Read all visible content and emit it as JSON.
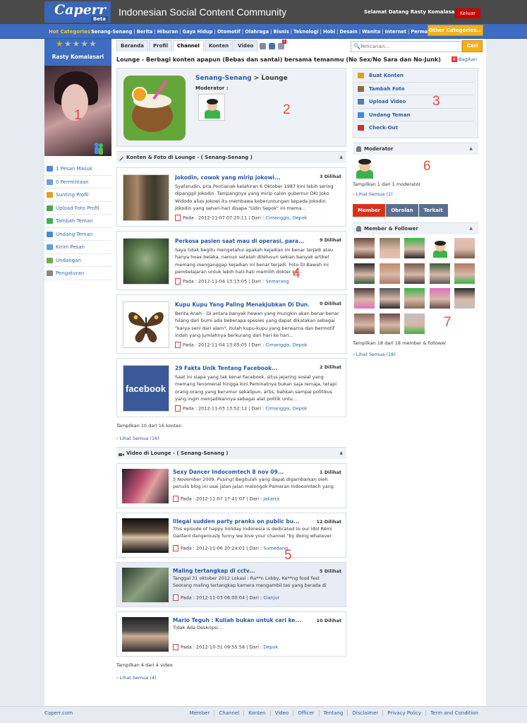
{
  "header": {
    "logo_text": "Caperr",
    "logo_badge": "Beta",
    "tagline": "Indonesian Social Content Community",
    "welcome": "Selamat Datang Rasty Komalasari,",
    "logout_label": "Keluar"
  },
  "categories": {
    "label": "Hot Categories :",
    "items": [
      "Senang-Senang",
      "Berita",
      "Hiburan",
      "Gaya Hidup",
      "Otomotif",
      "Olahraga",
      "Bisnis",
      "Teknologi",
      "Hobi",
      "Desain",
      "Wanita",
      "Internet",
      "Permainan"
    ],
    "other_label": "Other Categories..."
  },
  "profile": {
    "name": "Rasty Komalasari",
    "rating": 1,
    "rating_max": 5,
    "annotation": "1",
    "menu": [
      {
        "label": "1 Pesan Masuk",
        "icon": "mail-icon"
      },
      {
        "label": "0 Permintaan",
        "icon": "request-icon"
      },
      {
        "label": "Sunting Profil",
        "icon": "edit-icon"
      },
      {
        "label": "Upload Foto Profil",
        "icon": "photo-upload-icon"
      },
      {
        "label": "Tambah Teman",
        "icon": "add-friend-icon"
      },
      {
        "label": "Undang Teman",
        "icon": "invite-friend-icon"
      },
      {
        "label": "Kirim Pesan",
        "icon": "send-message-icon"
      },
      {
        "label": "Undangan",
        "icon": "invitation-icon"
      },
      {
        "label": "Pengaturan",
        "icon": "settings-icon"
      }
    ]
  },
  "tabs": [
    {
      "label": "Beranda",
      "active": false
    },
    {
      "label": "Profil",
      "active": false
    },
    {
      "label": "Channel",
      "active": true
    },
    {
      "label": "Konten",
      "active": false
    },
    {
      "label": "Video",
      "active": false
    }
  ],
  "notification_count": "1",
  "search": {
    "placeholder": "Pencarian...",
    "button_label": "Cari"
  },
  "page_title": "Lounge - Berbagi konten apapun (Bebas dan santai) bersama temanmu (No Sex/No Sara dan No-Junk)",
  "share_label": "Bagikan",
  "channel": {
    "category": "Senang-Senang",
    "name": "> Lounge",
    "moderator_label": "Moderator :",
    "annotation": "2"
  },
  "content_section": {
    "title": "Konten & Foto di Lounge - ( Senang-Senang )",
    "annotation": "4",
    "items": [
      {
        "title": "Jokodin, cowok yang mirip jokowi...",
        "views": "3 Dilihat",
        "desc": "Syafarudin, pria Pontianak kelahiran 6 Oktober 1987 kini lebih sering dipanggil Jokodin. Tampangnya yang mirip calon gubernur DKI Joko Widodo alias Jokowi itu membawa keberuntungan kepada Jokodin. Jokodin yang sehari-hari disapa \"Udin Sepok\" ini mema...",
        "date": "Pada : 2012-11-07 07:20:11",
        "from_label": "Dari :",
        "from": "Cimanggis, Depok"
      },
      {
        "title": "Perkosa pasien saat mau di operasi, para...",
        "views": "9 Dilihat",
        "desc": "Saya tidak begitu mengetahui apakah kejadian ini benar terjadi atau hanya hoax belaka, namun setelah ditelusuri sekian banyak artikel memang menganggap kejadian ini benar terjadi. Foto Di Bawah ini pembelajaran untuk lebih hati-hati memilih dokter ka...",
        "date": "Pada : 2012-11-04 13:13:05",
        "from_label": "Dari :",
        "from": "Semarang"
      },
      {
        "title": "Kupu Kupu Yang Paling Menakjubkan Di Dun...",
        "views": "0 Dilihat",
        "desc": "Berita Aneh - Di antara banyak hewan yang mungkin akan benar-benar hilang dari bumi ada beberapa spesies yang dapat dikatakan sebagai \"karya seni dari alam\", itulah kupu-kupu yang berwarna dan bermotif indah yang jumlahnya berkurang dari hari ke hari...",
        "date": "Pada : 2012-11-04 13:05:05",
        "from_label": "Dari :",
        "from": "Cimanggis, Depok"
      },
      {
        "title": "29 Fakta Unik Tentang Facebook...",
        "views": "2 Dilihat",
        "desc": "Saat ini siapa yang tak kenal Facebook, situs jejaring sosial yang memang fenomenal hingga kini.Peminatnya bukan saja remaja, tetapi orang-orang yang berumur sekalipun, artis, bahkan sampai politikus yang ingin menjadikannya sebagai alat politik untu...",
        "date": "Pada : 2012-11-03 13:52:12",
        "from_label": "Dari :",
        "from": "Cimanggis, Depok",
        "thumb_text": "facebook"
      }
    ],
    "count_text": "Tampilkan 10 dari 16 konten",
    "see_all": "Lihat Semua (16)"
  },
  "video_section": {
    "title": "Video di Lounge - ( Senang-Senang )",
    "annotation": "5",
    "items": [
      {
        "title": "Sexy Dancer Indocomtech 8 nov 09...",
        "views": "1 Dilihat",
        "desc": "5 November 2009. Pusing! Begitulah yang dapat digambarkan oleh penulis blog ini usai jalan-jalan melongok Pameran Indocomtech yang diselenggarakan di ...",
        "date": "Pada : 2012-11-07 17:41:07",
        "from_label": "Dari :",
        "from": "Jakarta"
      },
      {
        "title": "Illegal sudden party pranks on public bu...",
        "views": "12 Dilihat",
        "desc": "This episode of happy holiday Indonesia is dedicated to our idol Rémi Gaillard dangerously funny we love your channel \"by doing whatever anybody can b...",
        "date": "Pada : 2012-11-06 20:24:01",
        "from_label": "Dari :",
        "from": "Sumedang"
      },
      {
        "title": "Maling tertangkap di cctv...",
        "views": "5 Dilihat",
        "desc": "Tanggal 31 oktober 2012 Lokasi : Ra**n Lobby, Ke**ng food fest Seorang maling tertangkap kamera mengambil tas yang berada di sekitar kaki ( kiri...",
        "date": "Pada : 2012-11-03 06:00:04",
        "from_label": "Dari :",
        "from": "Cianjur"
      },
      {
        "title": "Mario Teguh : Kuliah bukan untuk cari ke...",
        "views": "10 Dilihat",
        "desc": "Tidak Ada Deskripsi...",
        "date": "Pada : 2012-10-31 09:55:58",
        "from_label": "Dari :",
        "from": "Depok"
      }
    ],
    "count_text": "Tampilkan 4 dari 4 video",
    "see_all": "Lihat Semua (4)"
  },
  "actions": {
    "annotation": "3",
    "items": [
      {
        "label": "Buat Konten",
        "icon": "write-icon"
      },
      {
        "label": "Tambah Foto",
        "icon": "add-photo-icon"
      },
      {
        "label": "Upload Video",
        "icon": "video-upload-icon"
      },
      {
        "label": "Undang Teman",
        "icon": "invite-icon"
      },
      {
        "label": "Check-Out",
        "icon": "close-icon"
      }
    ]
  },
  "moderator_panel": {
    "title": "Moderator",
    "count_text": "Tampilkan 1 dari 1 moderator",
    "see_all": "Lihat Semua (1)",
    "annotation": "6"
  },
  "member_tabs": [
    {
      "label": "Member",
      "color": "#d9301c"
    },
    {
      "label": "Obrolan",
      "color": "#5a6f8f"
    },
    {
      "label": "Terkait",
      "color": "#5a6f8f"
    }
  ],
  "members_panel": {
    "title": "Member & Follower",
    "count_text": "Tampilkan 18 dari 18 member & follower",
    "see_all": "Lihat Semua (18)",
    "annotation": "7",
    "member_count": 18
  },
  "footer": {
    "site": "Caperr.com",
    "links": [
      "Member",
      "Channel",
      "Konten",
      "Video",
      "Officer",
      "Tentang",
      "Disclaimer",
      "Privacy Policy",
      "Term and Condition"
    ]
  },
  "colors": {
    "brand_blue": "#3d6cc0",
    "accent_orange": "#f3b11d",
    "logout_red": "#cc0000",
    "link": "#2a58a8"
  }
}
